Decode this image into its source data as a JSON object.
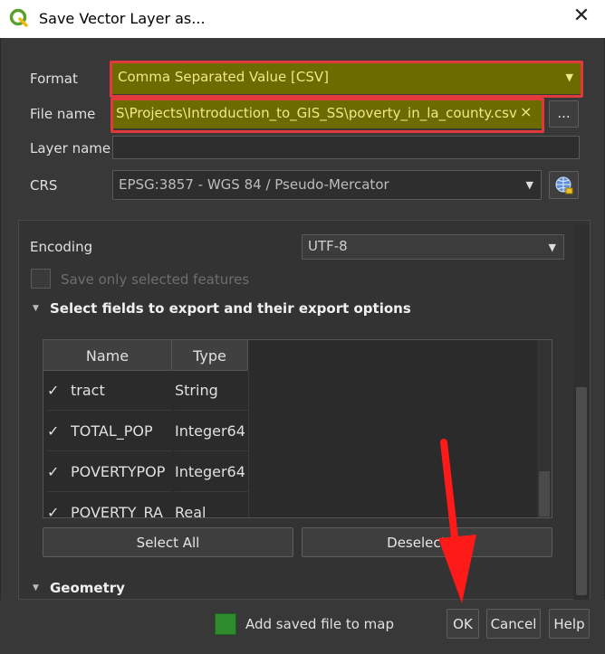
{
  "window": {
    "title": "Save Vector Layer as...",
    "close_glyph": "✕"
  },
  "form": {
    "format_label": "Format",
    "format_value": "Comma Separated Value [CSV]",
    "filename_label": "File name",
    "filename_value": "S\\Projects\\Introduction_to_GIS_SS\\poverty_in_la_county.csv",
    "filename_clear_glyph": "×",
    "browse_label": "...",
    "layername_label": "Layer name",
    "layername_value": "",
    "crs_label": "CRS",
    "crs_value": "EPSG:3857 - WGS 84 / Pseudo-Mercator"
  },
  "options": {
    "encoding_label": "Encoding",
    "encoding_value": "UTF-8",
    "selected_only_label": "Save only selected features",
    "fields_section_title": "Select fields to export and their export options",
    "geometry_section_title": "Geometry"
  },
  "fields_table": {
    "headers": [
      "Name",
      "Type"
    ],
    "rows": [
      {
        "check": "✓",
        "name": "tract",
        "type": "String"
      },
      {
        "check": "✓",
        "name": "TOTAL_POP",
        "type": "Integer64"
      },
      {
        "check": "✓",
        "name": "POVERTYPOP",
        "type": "Integer64"
      },
      {
        "check": "✓",
        "name": "POVERTY_RA",
        "type": "Real"
      }
    ]
  },
  "buttons": {
    "select_all": "Select All",
    "deselect_all": "Deselect All",
    "add_to_map": "Add saved file to map",
    "ok": "OK",
    "cancel": "Cancel",
    "help": "Help"
  },
  "colors": {
    "accent_highlight": "#6b6b00",
    "annotation_red": "#e23a3a",
    "checkbox_green": "#2e8b2e"
  }
}
